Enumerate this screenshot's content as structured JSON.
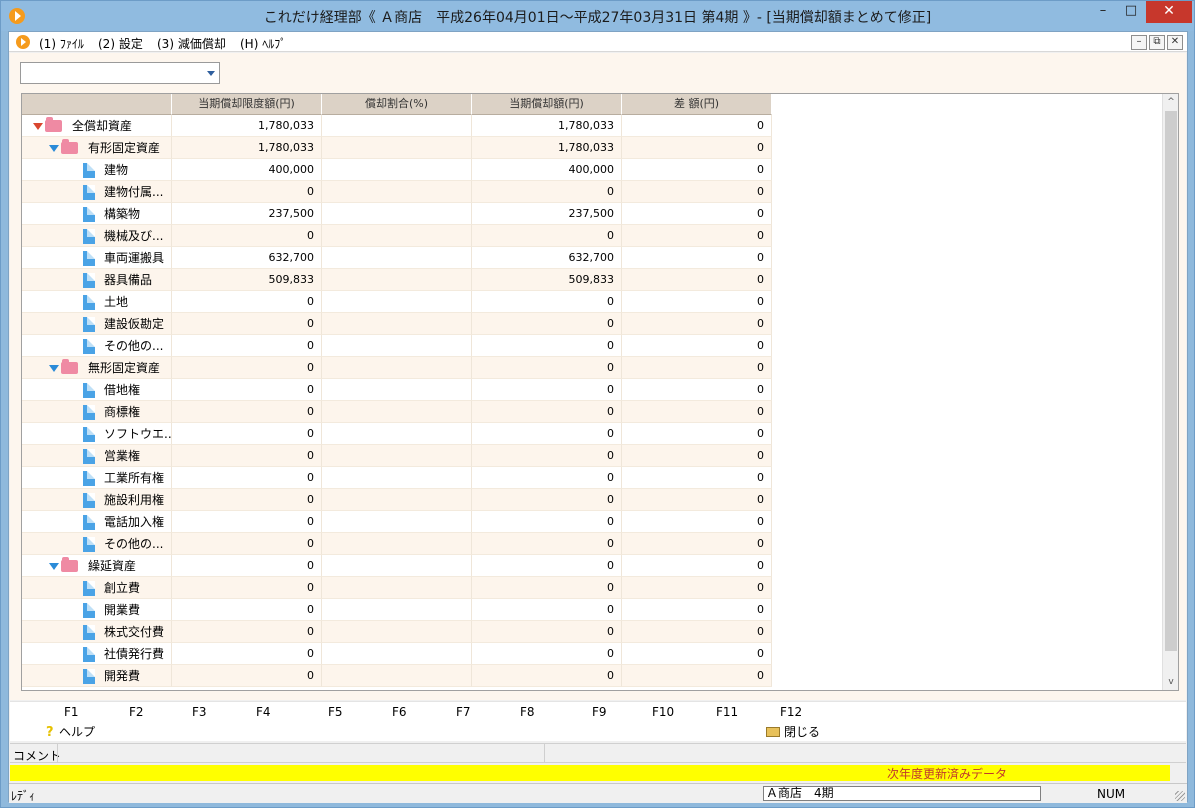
{
  "window": {
    "title": "これだけ経理部《 Ａ商店　平成26年04月01日～平成27年03月31日 第4期 》- [当期償却額まとめて修正]",
    "minimize_glyph": "–",
    "maximize_glyph": "□",
    "close_glyph": "✕"
  },
  "menu": [
    {
      "label": "(1) ﾌｧｲﾙ"
    },
    {
      "label": "(2) 設定"
    },
    {
      "label": "(3) 減価償却"
    },
    {
      "label": "(H) ﾍﾙﾌﾟ"
    }
  ],
  "mdi_controls": [
    "–",
    "⧉",
    "✕"
  ],
  "combo": {
    "value": ""
  },
  "table": {
    "headers": [
      "",
      "当期償却限度額(円)",
      "償却割合(%)",
      "当期償却額(円)",
      "差 額(円)"
    ],
    "rows": [
      {
        "level": 0,
        "kind": "group-top",
        "name": "全償却資産",
        "limit": "1,780,033",
        "rate": "",
        "amount": "1,780,033",
        "diff": "0"
      },
      {
        "level": 1,
        "kind": "group",
        "name": "有形固定資産",
        "limit": "1,780,033",
        "rate": "",
        "amount": "1,780,033",
        "diff": "0"
      },
      {
        "level": 2,
        "kind": "item",
        "name": "建物",
        "limit": "400,000",
        "rate": "",
        "amount": "400,000",
        "diff": "0"
      },
      {
        "level": 2,
        "kind": "item",
        "name": "建物付属...",
        "limit": "0",
        "rate": "",
        "amount": "0",
        "diff": "0"
      },
      {
        "level": 2,
        "kind": "item",
        "name": "構築物",
        "limit": "237,500",
        "rate": "",
        "amount": "237,500",
        "diff": "0"
      },
      {
        "level": 2,
        "kind": "item",
        "name": "機械及び...",
        "limit": "0",
        "rate": "",
        "amount": "0",
        "diff": "0"
      },
      {
        "level": 2,
        "kind": "item",
        "name": "車両運搬具",
        "limit": "632,700",
        "rate": "",
        "amount": "632,700",
        "diff": "0"
      },
      {
        "level": 2,
        "kind": "item",
        "name": "器具備品",
        "limit": "509,833",
        "rate": "",
        "amount": "509,833",
        "diff": "0"
      },
      {
        "level": 2,
        "kind": "item",
        "name": "土地",
        "limit": "0",
        "rate": "",
        "amount": "0",
        "diff": "0"
      },
      {
        "level": 2,
        "kind": "item",
        "name": "建設仮勘定",
        "limit": "0",
        "rate": "",
        "amount": "0",
        "diff": "0"
      },
      {
        "level": 2,
        "kind": "item",
        "name": "その他の...",
        "limit": "0",
        "rate": "",
        "amount": "0",
        "diff": "0"
      },
      {
        "level": 1,
        "kind": "group",
        "name": "無形固定資産",
        "limit": "0",
        "rate": "",
        "amount": "0",
        "diff": "0"
      },
      {
        "level": 2,
        "kind": "item",
        "name": "借地権",
        "limit": "0",
        "rate": "",
        "amount": "0",
        "diff": "0"
      },
      {
        "level": 2,
        "kind": "item",
        "name": "商標権",
        "limit": "0",
        "rate": "",
        "amount": "0",
        "diff": "0"
      },
      {
        "level": 2,
        "kind": "item",
        "name": "ソフトウエ...",
        "limit": "0",
        "rate": "",
        "amount": "0",
        "diff": "0"
      },
      {
        "level": 2,
        "kind": "item",
        "name": "営業権",
        "limit": "0",
        "rate": "",
        "amount": "0",
        "diff": "0"
      },
      {
        "level": 2,
        "kind": "item",
        "name": "工業所有権",
        "limit": "0",
        "rate": "",
        "amount": "0",
        "diff": "0"
      },
      {
        "level": 2,
        "kind": "item",
        "name": "施設利用権",
        "limit": "0",
        "rate": "",
        "amount": "0",
        "diff": "0"
      },
      {
        "level": 2,
        "kind": "item",
        "name": "電話加入権",
        "limit": "0",
        "rate": "",
        "amount": "0",
        "diff": "0"
      },
      {
        "level": 2,
        "kind": "item",
        "name": "その他の...",
        "limit": "0",
        "rate": "",
        "amount": "0",
        "diff": "0"
      },
      {
        "level": 1,
        "kind": "group",
        "name": "繰延資産",
        "limit": "0",
        "rate": "",
        "amount": "0",
        "diff": "0"
      },
      {
        "level": 2,
        "kind": "item",
        "name": "創立費",
        "limit": "0",
        "rate": "",
        "amount": "0",
        "diff": "0"
      },
      {
        "level": 2,
        "kind": "item",
        "name": "開業費",
        "limit": "0",
        "rate": "",
        "amount": "0",
        "diff": "0"
      },
      {
        "level": 2,
        "kind": "item",
        "name": "株式交付費",
        "limit": "0",
        "rate": "",
        "amount": "0",
        "diff": "0"
      },
      {
        "level": 2,
        "kind": "item",
        "name": "社債発行費",
        "limit": "0",
        "rate": "",
        "amount": "0",
        "diff": "0"
      },
      {
        "level": 2,
        "kind": "item",
        "name": "開発費",
        "limit": "0",
        "rate": "",
        "amount": "0",
        "diff": "0"
      }
    ]
  },
  "scrollbar": {
    "up_glyph": "^",
    "down_glyph": "v"
  },
  "fkeys": {
    "labels": [
      "F1",
      "F2",
      "F3",
      "F4",
      "F5",
      "F6",
      "F7",
      "F8",
      "F9",
      "F10",
      "F11",
      "F12"
    ],
    "help_label": "ヘルプ",
    "close_label": "閉じる"
  },
  "comment": {
    "label": "コメント"
  },
  "notice": {
    "text": "次年度更新済みデータ"
  },
  "status": {
    "ready": "ﾚﾃﾞｨ",
    "company": "Ａ商店　4期",
    "num": "NUM"
  },
  "colors": {
    "accent": "#90bbe0",
    "notice_bg": "#ffff00",
    "notice_text": "#c0392b",
    "close_btn": "#c7372c"
  }
}
